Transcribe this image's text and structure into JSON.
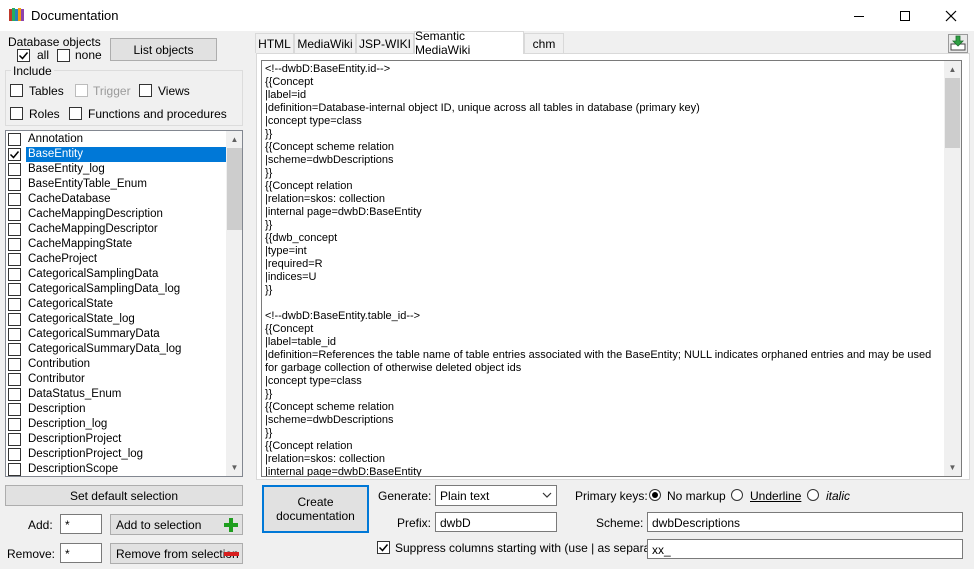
{
  "window": {
    "title": "Documentation"
  },
  "db_objects": {
    "label": "Database objects",
    "all_label": "all",
    "none_label": "none",
    "list_button": "List objects"
  },
  "include": {
    "label": "Include",
    "tables": "Tables",
    "trigger": "Trigger",
    "views": "Views",
    "roles": "Roles",
    "functions": "Functions and procedures"
  },
  "objects": [
    {
      "name": "Annotation",
      "checked": false
    },
    {
      "name": "BaseEntity",
      "checked": true,
      "selected": true
    },
    {
      "name": "BaseEntity_log",
      "checked": false
    },
    {
      "name": "BaseEntityTable_Enum",
      "checked": false
    },
    {
      "name": "CacheDatabase",
      "checked": false
    },
    {
      "name": "CacheMappingDescription",
      "checked": false
    },
    {
      "name": "CacheMappingDescriptor",
      "checked": false
    },
    {
      "name": "CacheMappingState",
      "checked": false
    },
    {
      "name": "CacheProject",
      "checked": false
    },
    {
      "name": "CategoricalSamplingData",
      "checked": false
    },
    {
      "name": "CategoricalSamplingData_log",
      "checked": false
    },
    {
      "name": "CategoricalState",
      "checked": false
    },
    {
      "name": "CategoricalState_log",
      "checked": false
    },
    {
      "name": "CategoricalSummaryData",
      "checked": false
    },
    {
      "name": "CategoricalSummaryData_log",
      "checked": false
    },
    {
      "name": "Contribution",
      "checked": false
    },
    {
      "name": "Contributor",
      "checked": false
    },
    {
      "name": "DataStatus_Enum",
      "checked": false
    },
    {
      "name": "Description",
      "checked": false
    },
    {
      "name": "Description_log",
      "checked": false
    },
    {
      "name": "DescriptionProject",
      "checked": false
    },
    {
      "name": "DescriptionProject_log",
      "checked": false
    },
    {
      "name": "DescriptionScope",
      "checked": false
    }
  ],
  "selection": {
    "default_button": "Set default selection",
    "add_label": "Add:",
    "add_value": "*",
    "add_button": "Add to selection",
    "remove_label": "Remove:",
    "remove_value": "*",
    "remove_button": "Remove from selection"
  },
  "tabs": [
    "HTML",
    "MediaWiki",
    "JSP-WIKI",
    "Semantic MediaWiki",
    "chm"
  ],
  "active_tab": "Semantic MediaWiki",
  "output_text": "<!--dwbD:BaseEntity.id-->\n{{Concept\n|label=id\n|definition=Database-internal object ID, unique across all tables in database (primary key)\n|concept type=class\n}}\n{{Concept scheme relation\n|scheme=dwbDescriptions\n}}\n{{Concept relation\n|relation=skos: collection\n|internal page=dwbD:BaseEntity\n}}\n{{dwb_concept\n|type=int\n|required=R\n|indices=U\n}}\n\n<!--dwbD:BaseEntity.table_id-->\n{{Concept\n|label=table_id\n|definition=References the table name of table entries associated with the BaseEntity; NULL indicates orphaned entries and may be used for garbage collection of otherwise deleted object ids\n|concept type=class\n}}\n{{Concept scheme relation\n|scheme=dwbDescriptions\n}}\n{{Concept relation\n|relation=skos: collection\n|internal page=dwbD:BaseEntity\n}}",
  "options": {
    "create_button": "Create documentation",
    "generate_label": "Generate:",
    "generate_value": "Plain text",
    "primary_keys_label": "Primary keys:",
    "pk_no_markup": "No markup",
    "pk_underline": "Underline",
    "pk_italic": "italic",
    "prefix_label": "Prefix:",
    "prefix_value": "dwbD",
    "scheme_label": "Scheme:",
    "scheme_value": "dwbDescriptions",
    "suppress_label": "Suppress columns starting with (use | as separator):",
    "suppress_value": "xx_"
  },
  "colors": {
    "selection": "#0078d7",
    "add_icon": "#1f9e1f",
    "remove_icon": "#d81e1e"
  }
}
